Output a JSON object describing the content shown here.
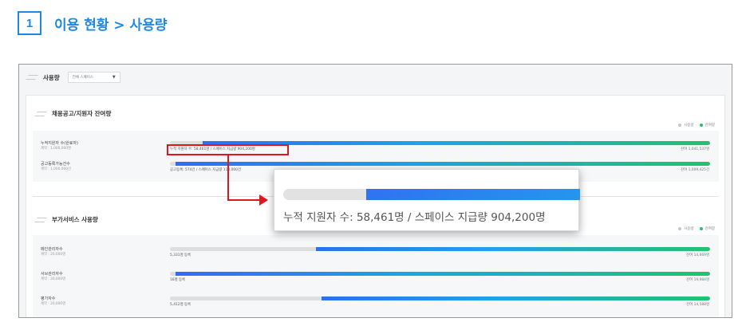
{
  "step": {
    "number": "1",
    "title": "이용 현황 > 사용량"
  },
  "topbar": {
    "title": "사용량",
    "select_value": "전체 스페이스"
  },
  "colors": {
    "accent": "#1e88e5",
    "highlight": "#e0161b",
    "used": "#dcdcdc",
    "remain": "#21c36d"
  },
  "legend": {
    "used": "사용량",
    "remain": "잔여량"
  },
  "section1": {
    "title": "채용공고/지원자 잔여량",
    "rows": [
      {
        "label": "누적지원자 수(완료자)",
        "sub": "계약 : 1,000,000명",
        "text": "누적 지원자 수: 58,461명 / 스페이스 지급량 904,200명",
        "remain": "잔여 1,041,537명",
        "remain_frac": 0.94
      },
      {
        "label": "공고등록가능건수",
        "sub": "계약 : 1,000,000건",
        "text": "공고등록: 574건 / 스페이스 지급량 110,000건",
        "remain": "잔여 1,009,425건",
        "remain_frac": 0.99
      }
    ]
  },
  "section2": {
    "title": "부가서비스 사용량",
    "rows": [
      {
        "label": "메인관리자수",
        "sub": "계약 : 20,000명",
        "text": "5,331명 등록",
        "remain": "잔여 14,669명",
        "remain_frac": 0.73
      },
      {
        "label": "서브관리자수",
        "sub": "계약 : 20,000명",
        "text": "16명 등록",
        "remain": "잔여 19,984명",
        "remain_frac": 0.99
      },
      {
        "label": "평가자수",
        "sub": "계약 : 20,000명",
        "text": "5,412명 등록",
        "remain": "잔여 14,588명",
        "remain_frac": 0.72
      }
    ]
  },
  "zoom": {
    "text": "누적 지원자 수: 58,461명 / 스페이스 지급량 904,200명",
    "remain_frac": 0.72
  }
}
